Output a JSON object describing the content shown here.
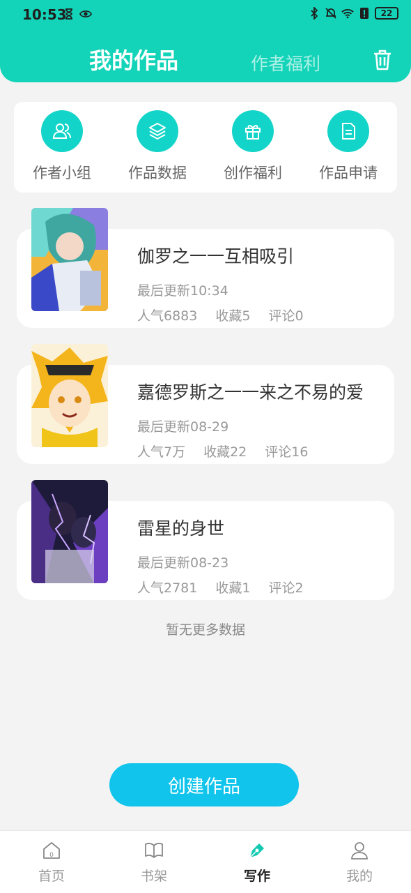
{
  "status": {
    "time": "10:53",
    "battery": "22"
  },
  "header": {
    "tab_active": "我的作品",
    "tab_inactive": "作者福利"
  },
  "quick_actions": [
    {
      "label": "作者小组",
      "icon": "people-icon"
    },
    {
      "label": "作品数据",
      "icon": "layers-icon"
    },
    {
      "label": "创作福利",
      "icon": "gift-icon"
    },
    {
      "label": "作品申请",
      "icon": "document-icon"
    }
  ],
  "works": [
    {
      "title": "伽罗之一一互相吸引",
      "updated": "最后更新10:34",
      "popularity": "人气6883",
      "favorites": "收藏5",
      "comments": "评论0"
    },
    {
      "title": "嘉德罗斯之一一来之不易的爱",
      "updated": "最后更新08-29",
      "popularity": "人气7万",
      "favorites": "收藏22",
      "comments": "评论16"
    },
    {
      "title": "雷星的身世",
      "updated": "最后更新08-23",
      "popularity": "人气2781",
      "favorites": "收藏1",
      "comments": "评论2"
    }
  ],
  "no_more": "暂无更多数据",
  "create_button": "创建作品",
  "nav": [
    {
      "label": "首页",
      "icon": "home-icon"
    },
    {
      "label": "书架",
      "icon": "book-icon"
    },
    {
      "label": "写作",
      "icon": "pen-icon"
    },
    {
      "label": "我的",
      "icon": "user-icon"
    }
  ],
  "colors": {
    "accent": "#13d4b8",
    "button": "#10c4ec"
  }
}
